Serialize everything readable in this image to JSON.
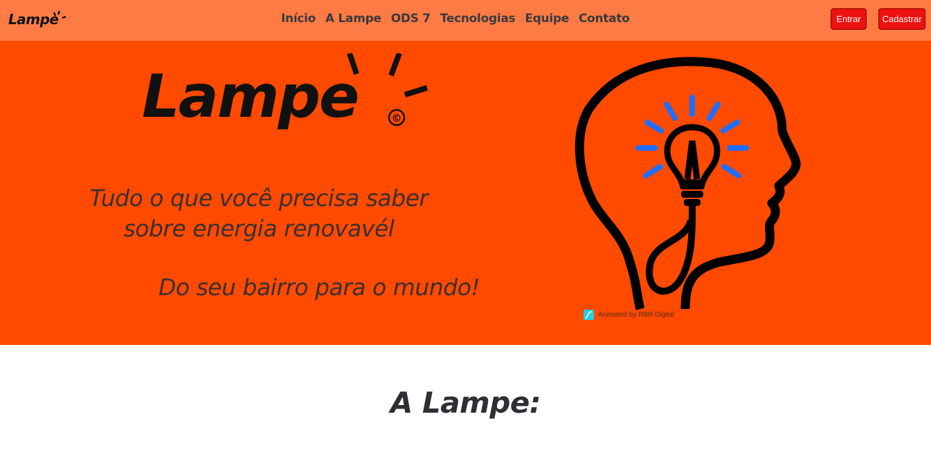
{
  "navbar": {
    "brand": "Lampe",
    "links": [
      "Início",
      "A Lampe",
      "ODS 7",
      "Tecnologias",
      "Equipe",
      "Contato"
    ],
    "login_label": "Entrar",
    "signup_label": "Cadastrar"
  },
  "hero": {
    "logo_text": "Lampe",
    "logo_mark": "©",
    "tagline_line1": "Tudo o que você precisa saber",
    "tagline_line2": "sobre energia renovavél",
    "slogan": "Do seu bairro para o mundo!",
    "credit": "Animated by RBR Digital",
    "illustration_icon": "head-with-lightbulb-icon"
  },
  "section": {
    "title": "A Lampe:"
  },
  "colors": {
    "navbar": "#ff7b45",
    "hero": "#ff4a00",
    "button": "#ee1111",
    "bulb_rays": "#1e6fff"
  }
}
